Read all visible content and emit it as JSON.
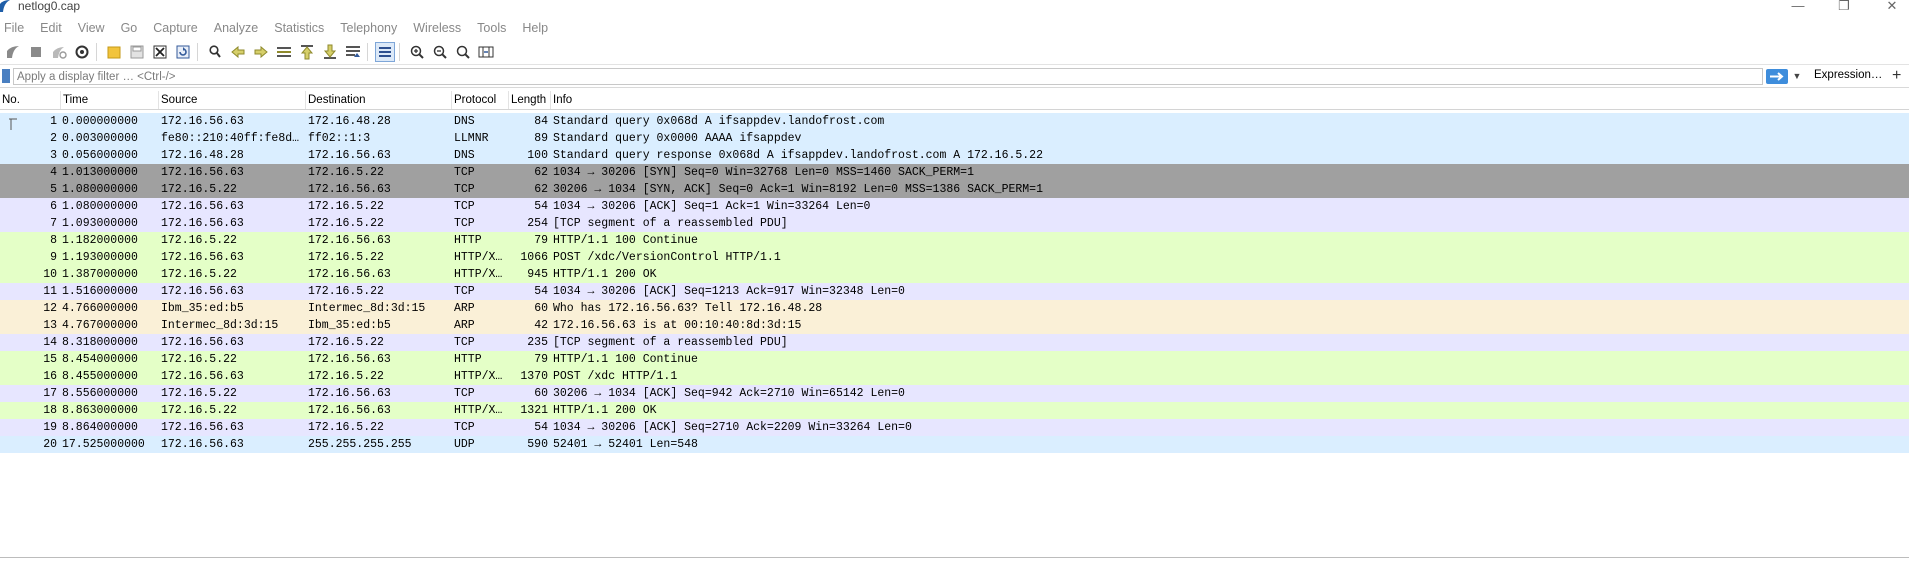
{
  "window": {
    "title": "netlog0.cap",
    "controls": {
      "minimize": "—",
      "maximize": "❐",
      "close": "✕"
    }
  },
  "menu": [
    "File",
    "Edit",
    "View",
    "Go",
    "Capture",
    "Analyze",
    "Statistics",
    "Telephony",
    "Wireless",
    "Tools",
    "Help"
  ],
  "toolbar": {
    "icons": [
      "shark-fin-start-icon",
      "stop-square-icon",
      "restart-fin-icon",
      "capture-options-gear-icon",
      "open-folder-icon",
      "save-file-icon",
      "close-file-icon",
      "reload-file-icon",
      "find-magnifier-icon",
      "go-back-arrow-icon",
      "go-forward-arrow-icon",
      "go-to-packet-icon",
      "first-packet-icon",
      "last-packet-icon",
      "autoscroll-icon",
      "colorize-list-icon",
      "zoom-in-icon",
      "zoom-out-icon",
      "zoom-normal-icon",
      "resize-columns-icon"
    ]
  },
  "filter": {
    "placeholder": "Apply a display filter … <Ctrl-/>",
    "expression_label": "Expression…",
    "plus_label": "+"
  },
  "columns": [
    "No.",
    "Time",
    "Source",
    "Destination",
    "Protocol",
    "Length",
    "Info"
  ],
  "colors": {
    "dns_udp": "#daeeff",
    "tcp": "#e7e6ff",
    "syn": "#a0a0a0",
    "http": "#e4ffc7",
    "arp": "#faf0d7"
  },
  "packets": [
    {
      "no": "1",
      "time": "0.000000000",
      "src": "172.16.56.63",
      "dst": "172.16.48.28",
      "proto": "DNS",
      "len": "84",
      "info": "Standard query 0x068d A ifsappdev.landofrost.com",
      "color": "#daeeff",
      "selected": true
    },
    {
      "no": "2",
      "time": "0.003000000",
      "src": "fe80::210:40ff:fe8d…",
      "dst": "ff02::1:3",
      "proto": "LLMNR",
      "len": "89",
      "info": "Standard query 0x0000 AAAA ifsappdev",
      "color": "#daeeff"
    },
    {
      "no": "3",
      "time": "0.056000000",
      "src": "172.16.48.28",
      "dst": "172.16.56.63",
      "proto": "DNS",
      "len": "100",
      "info": "Standard query response 0x068d A ifsappdev.landofrost.com A 172.16.5.22",
      "color": "#daeeff"
    },
    {
      "no": "4",
      "time": "1.013000000",
      "src": "172.16.56.63",
      "dst": "172.16.5.22",
      "proto": "TCP",
      "len": "62",
      "info": "1034 → 30206 [SYN] Seq=0 Win=32768 Len=0 MSS=1460 SACK_PERM=1",
      "color": "#a0a0a0"
    },
    {
      "no": "5",
      "time": "1.080000000",
      "src": "172.16.5.22",
      "dst": "172.16.56.63",
      "proto": "TCP",
      "len": "62",
      "info": "30206 → 1034 [SYN, ACK] Seq=0 Ack=1 Win=8192 Len=0 MSS=1386 SACK_PERM=1",
      "color": "#a0a0a0"
    },
    {
      "no": "6",
      "time": "1.080000000",
      "src": "172.16.56.63",
      "dst": "172.16.5.22",
      "proto": "TCP",
      "len": "54",
      "info": "1034 → 30206 [ACK] Seq=1 Ack=1 Win=33264 Len=0",
      "color": "#e7e6ff"
    },
    {
      "no": "7",
      "time": "1.093000000",
      "src": "172.16.56.63",
      "dst": "172.16.5.22",
      "proto": "TCP",
      "len": "254",
      "info": "[TCP segment of a reassembled PDU]",
      "color": "#e7e6ff"
    },
    {
      "no": "8",
      "time": "1.182000000",
      "src": "172.16.5.22",
      "dst": "172.16.56.63",
      "proto": "HTTP",
      "len": "79",
      "info": "HTTP/1.1 100 Continue",
      "color": "#e4ffc7"
    },
    {
      "no": "9",
      "time": "1.193000000",
      "src": "172.16.56.63",
      "dst": "172.16.5.22",
      "proto": "HTTP/X…",
      "len": "1066",
      "info": "POST /xdc/VersionControl HTTP/1.1",
      "color": "#e4ffc7"
    },
    {
      "no": "10",
      "time": "1.387000000",
      "src": "172.16.5.22",
      "dst": "172.16.56.63",
      "proto": "HTTP/X…",
      "len": "945",
      "info": "HTTP/1.1 200 OK",
      "color": "#e4ffc7"
    },
    {
      "no": "11",
      "time": "1.516000000",
      "src": "172.16.56.63",
      "dst": "172.16.5.22",
      "proto": "TCP",
      "len": "54",
      "info": "1034 → 30206 [ACK] Seq=1213 Ack=917 Win=32348 Len=0",
      "color": "#e7e6ff"
    },
    {
      "no": "12",
      "time": "4.766000000",
      "src": "Ibm_35:ed:b5",
      "dst": "Intermec_8d:3d:15",
      "proto": "ARP",
      "len": "60",
      "info": "Who has 172.16.56.63? Tell 172.16.48.28",
      "color": "#faf0d7"
    },
    {
      "no": "13",
      "time": "4.767000000",
      "src": "Intermec_8d:3d:15",
      "dst": "Ibm_35:ed:b5",
      "proto": "ARP",
      "len": "42",
      "info": "172.16.56.63 is at 00:10:40:8d:3d:15",
      "color": "#faf0d7"
    },
    {
      "no": "14",
      "time": "8.318000000",
      "src": "172.16.56.63",
      "dst": "172.16.5.22",
      "proto": "TCP",
      "len": "235",
      "info": "[TCP segment of a reassembled PDU]",
      "color": "#e7e6ff"
    },
    {
      "no": "15",
      "time": "8.454000000",
      "src": "172.16.5.22",
      "dst": "172.16.56.63",
      "proto": "HTTP",
      "len": "79",
      "info": "HTTP/1.1 100 Continue",
      "color": "#e4ffc7"
    },
    {
      "no": "16",
      "time": "8.455000000",
      "src": "172.16.56.63",
      "dst": "172.16.5.22",
      "proto": "HTTP/X…",
      "len": "1370",
      "info": "POST /xdc HTTP/1.1",
      "color": "#e4ffc7"
    },
    {
      "no": "17",
      "time": "8.556000000",
      "src": "172.16.5.22",
      "dst": "172.16.56.63",
      "proto": "TCP",
      "len": "60",
      "info": "30206 → 1034 [ACK] Seq=942 Ack=2710 Win=65142 Len=0",
      "color": "#e7e6ff"
    },
    {
      "no": "18",
      "time": "8.863000000",
      "src": "172.16.5.22",
      "dst": "172.16.56.63",
      "proto": "HTTP/X…",
      "len": "1321",
      "info": "HTTP/1.1 200 OK",
      "color": "#e4ffc7"
    },
    {
      "no": "19",
      "time": "8.864000000",
      "src": "172.16.56.63",
      "dst": "172.16.5.22",
      "proto": "TCP",
      "len": "54",
      "info": "1034 → 30206 [ACK] Seq=2710 Ack=2209 Win=33264 Len=0",
      "color": "#e7e6ff"
    },
    {
      "no": "20",
      "time": "17.525000000",
      "src": "172.16.56.63",
      "dst": "255.255.255.255",
      "proto": "UDP",
      "len": "590",
      "info": "52401 → 52401 Len=548",
      "color": "#daeeff"
    }
  ]
}
